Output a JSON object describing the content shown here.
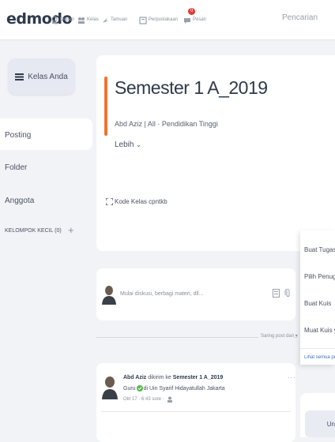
{
  "brand": {
    "logo": "edmodo"
  },
  "nav": [
    {
      "label": "Depan",
      "icon": "home-icon"
    },
    {
      "label": "Kelas",
      "icon": "classes-icon"
    },
    {
      "label": "Tamuan",
      "icon": "discover-icon"
    },
    {
      "label": "Perpustakaan",
      "icon": "library-icon"
    },
    {
      "label": "Pesan",
      "icon": "messages-icon",
      "badge": "0"
    }
  ],
  "search": {
    "placeholder": "Pencarian"
  },
  "sidebar": {
    "class_button": "Kelas Anda",
    "items": [
      "Posting",
      "Folder",
      "Anggota",
      "KELOMPOK KECIL (0)"
    ],
    "active": "Posting"
  },
  "class_info": {
    "title": "Semester 1 A_2019",
    "meta": "Abd Aziz | All · Pendidikan Tinggi",
    "more": "Lebih",
    "code_label": "Kode Kelas cpntkb"
  },
  "assign_menu": {
    "items": [
      "Buat Tugas",
      "Pilih Penugasan",
      "Buat Kuis",
      "Muat Kuis yang"
    ],
    "link": "Lihat semua peluang"
  },
  "composer": {
    "placeholder": "Mulai diskusi, berbagi materi, dll..."
  },
  "sort": {
    "label": "Saring post dari"
  },
  "post": {
    "author": "Abd Aziz",
    "action": "dikirim ke",
    "target": "Semester 1 A_2019",
    "role_prefix": "Guru",
    "role_suffix": "di Uin Syarif Hidayatullah Jakarta",
    "time": "Okt 17 · 6:43 sore ·",
    "more": "···"
  },
  "side_card": {
    "button": "Un"
  },
  "colors": {
    "accent": "#ef7530",
    "verified": "#54b948",
    "badge": "#e53935",
    "link": "#3f6fb6"
  }
}
